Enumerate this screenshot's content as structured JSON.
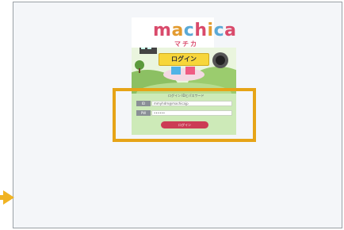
{
  "app": {
    "logo_text_parts": [
      "m",
      "a",
      "c",
      "h",
      "i",
      "c",
      "a"
    ],
    "logo_colors": [
      "#d94a6b",
      "#e39b2f",
      "#5aa9d6",
      "#d94a6b",
      "#e39b2f",
      "#5aa9d6",
      "#d94a6b"
    ],
    "subtitle": "マチカ",
    "banner": "ログイン"
  },
  "form": {
    "caption": "ログイン IDとパスワード",
    "user_label": "ID",
    "user_value": "mmyhdm@machicajp",
    "password_label": "PW",
    "password_value": "••••••",
    "submit_label": "ログイン"
  },
  "colors": {
    "highlight": "#e6a417",
    "form_bg": "#cdeab8",
    "submit": "#cc3c55"
  }
}
